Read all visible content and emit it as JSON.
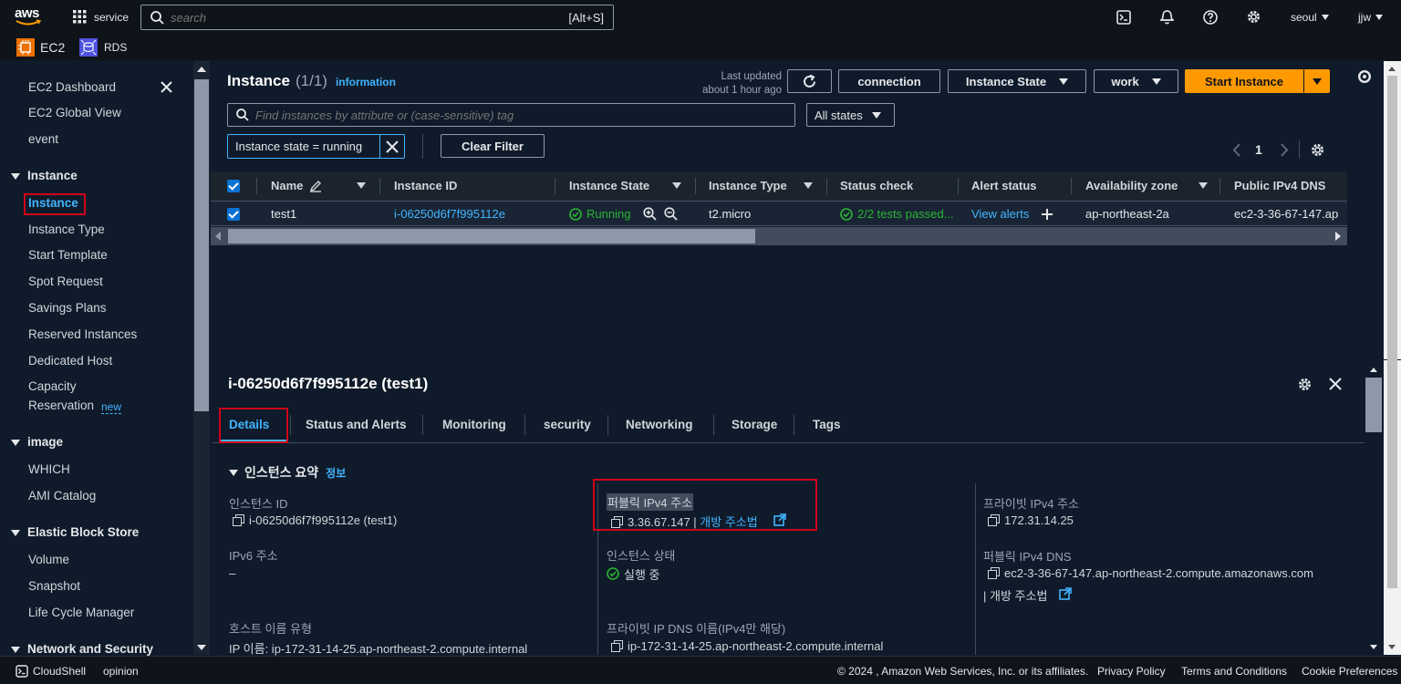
{
  "topbar": {
    "brand": "aws",
    "services_label": "service",
    "search_placeholder": "search",
    "search_shortcut": "[Alt+S]",
    "region": "seoul",
    "user": "jjw"
  },
  "service_bar": {
    "ec2": "EC2",
    "rds": "RDS"
  },
  "sidebar": {
    "top_items": [
      "EC2 Dashboard",
      "EC2 Global View",
      "event"
    ],
    "sections": [
      {
        "title": "Instance",
        "items": [
          "Instance",
          "Instance Type",
          "Start Template",
          "Spot Request",
          "Savings Plans",
          "Reserved Instances",
          "Dedicated Host",
          "Capacity",
          "Reservation"
        ]
      },
      {
        "title": "image",
        "items": [
          "WHICH",
          "AMI Catalog"
        ]
      },
      {
        "title": "Elastic Block Store",
        "items": [
          "Volume",
          "Snapshot",
          "Life Cycle Manager"
        ]
      },
      {
        "title": "Network and Security",
        "items": []
      }
    ],
    "new_badge": "new"
  },
  "instances": {
    "title": "Instance",
    "count": "(1/1)",
    "info": "information",
    "last_updated_line1": "Last updated",
    "last_updated_line2": "about 1 hour ago",
    "btn_connection": "connection",
    "btn_state": "Instance State",
    "btn_work": "work",
    "btn_start": "Start Instance",
    "filter_placeholder": "Find instances by attribute or (case-sensitive) tag",
    "state_filter": "All states",
    "chip": "Instance state = running",
    "clear_filter": "Clear Filter",
    "page": "1",
    "columns": [
      "Name",
      "Instance ID",
      "Instance State",
      "Instance Type",
      "Status check",
      "Alert status",
      "Availability zone",
      "Public IPv4 DNS"
    ],
    "row": {
      "name": "test1",
      "id": "i-06250d6f7f995112e",
      "state": "Running",
      "type": "t2.micro",
      "status_check": "2/2 tests passed...",
      "alert": "View alerts",
      "az": "ap-northeast-2a",
      "dns": "ec2-3-36-67-147.ap"
    }
  },
  "details": {
    "title": "i-06250d6f7f995112e (test1)",
    "tabs": [
      "Details",
      "Status and Alerts",
      "Monitoring",
      "security",
      "Networking",
      "Storage",
      "Tags"
    ],
    "section_title": "인스턴스 요약",
    "section_info": "정보",
    "fields": {
      "instance_id_label": "인스턴스 ID",
      "instance_id_value": "i-06250d6f7f995112e (test1)",
      "public_ipv4_label": "퍼블릭 IPv4 주소",
      "public_ipv4_value": "3.36.67.147 |",
      "open_address": "개방 주소법",
      "private_ipv4_label": "프라이빗 IPv4 주소",
      "private_ipv4_value": "172.31.14.25",
      "ipv6_label": "IPv6 주소",
      "ipv6_value": "–",
      "instance_state_label": "인스턴스 상태",
      "instance_state_value": "실행 중",
      "public_dns_label": "퍼블릭 IPv4 DNS",
      "public_dns_value": "ec2-3-36-67-147.ap-northeast-2.compute.amazonaws.com",
      "public_dns_open": "| 개방 주소법",
      "hostname_type_label": "호스트 이름 유형",
      "hostname_type_value": "IP 이름: ip-172-31-14-25.ap-northeast-2.compute.internal",
      "private_dns_label": "프라이빗 IP DNS 이름(IPv4만 해당)",
      "private_dns_value": "ip-172-31-14-25.ap-northeast-2.compute.internal"
    }
  },
  "footer": {
    "cloudshell": "CloudShell",
    "opinion": "opinion",
    "copyright": "© 2024 , Amazon Web Services, Inc. or its affiliates.",
    "privacy": "Privacy Policy",
    "terms": "Terms and Conditions",
    "cookies": "Cookie Preferences"
  },
  "colors": {
    "accent_orange": "#ff9900",
    "link_blue": "#42b4ff",
    "running_green": "#2bb534",
    "highlight_red": "#d0021b"
  }
}
